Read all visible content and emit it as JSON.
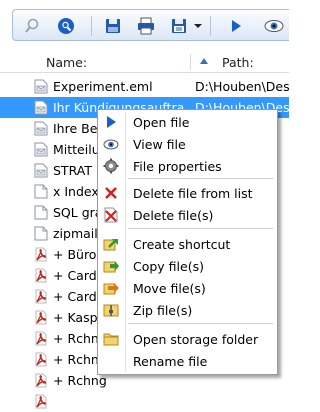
{
  "toolbar": {
    "buttons": [
      {
        "name": "search-icon"
      },
      {
        "name": "find-icon"
      },
      {
        "name": "save-icon"
      },
      {
        "name": "print-icon"
      },
      {
        "name": "export-icon"
      },
      {
        "name": "dropdown-arrow-icon"
      },
      {
        "name": "play-icon"
      },
      {
        "name": "view-icon"
      }
    ]
  },
  "columns": {
    "name": "Name:",
    "path": "Path:"
  },
  "rows": [
    {
      "name": "Experiment.eml",
      "path": "D:\\Houben\\Des",
      "icon": "email-file-icon"
    },
    {
      "name": "Ihr Kündigungsauftra",
      "path": "D:\\Houben\\Des",
      "icon": "email-file-icon",
      "selected": true
    },
    {
      "name": "Ihre Bes",
      "path": "",
      "icon": "email-file-icon"
    },
    {
      "name": "Mitteilun",
      "path": "",
      "icon": "email-file-icon"
    },
    {
      "name": "STRAT",
      "path": "",
      "icon": "email-file-icon"
    },
    {
      "name": "x Indexz",
      "path": "",
      "icon": "text-file-icon"
    },
    {
      "name": "SQL gra",
      "path": "",
      "icon": "text-file-icon"
    },
    {
      "name": "zipmailp",
      "path": "",
      "icon": "text-file-icon"
    },
    {
      "name": "+ Büros",
      "path": "",
      "icon": "pdf-file-icon"
    },
    {
      "name": "+ Cardr",
      "path": "",
      "icon": "pdf-file-icon"
    },
    {
      "name": "+ Cardr",
      "path": "",
      "icon": "pdf-file-icon"
    },
    {
      "name": "+ Kaspa",
      "path": "",
      "icon": "pdf-file-icon"
    },
    {
      "name": "+ Rchng",
      "path": "",
      "icon": "pdf-file-icon"
    },
    {
      "name": "+ Rchng",
      "path": "",
      "icon": "pdf-file-icon"
    },
    {
      "name": "+ Rchng",
      "path": "",
      "icon": "pdf-file-icon"
    },
    {
      "name": "",
      "path": "",
      "icon": "pdf-file-icon"
    }
  ],
  "menu": {
    "items": [
      {
        "label": "Open file",
        "icon": "play-icon",
        "name": "menu-open-file"
      },
      {
        "label": "View file",
        "icon": "view-icon",
        "name": "menu-view-file"
      },
      {
        "label": "File properties",
        "icon": "gear-icon",
        "name": "menu-file-properties"
      },
      {
        "label": "Delete file from list",
        "icon": "red-x-icon",
        "name": "menu-delete-from-list"
      },
      {
        "label": "Delete file(s)",
        "icon": "delete-files-icon",
        "name": "menu-delete-files"
      },
      {
        "label": "Create shortcut",
        "icon": "shortcut-icon",
        "name": "menu-create-shortcut"
      },
      {
        "label": "Copy file(s)",
        "icon": "copy-icon",
        "name": "menu-copy-files"
      },
      {
        "label": "Move file(s)",
        "icon": "move-icon",
        "name": "menu-move-files"
      },
      {
        "label": "Zip file(s)",
        "icon": "zip-icon",
        "name": "menu-zip-files"
      },
      {
        "label": "Open storage folder",
        "icon": "folder-icon",
        "name": "menu-open-storage-folder"
      },
      {
        "label": "Rename file",
        "icon": "",
        "name": "menu-rename-file"
      }
    ]
  },
  "colors": {
    "selection": "#3399ff",
    "accent": "#1a5fc7",
    "pdf": "#c0281e"
  }
}
